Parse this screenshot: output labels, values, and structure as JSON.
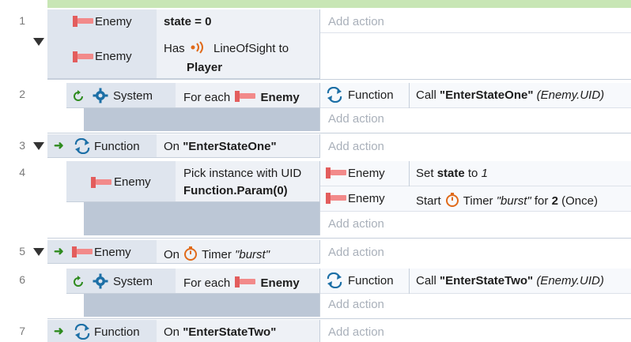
{
  "events": [
    {
      "number": "1",
      "conditions": [
        {
          "object": "Enemy",
          "text": "state = 0"
        },
        {
          "object": "Enemy",
          "has": "Has",
          "behavior": "LineOfSight",
          "to": "to",
          "target": "Player"
        }
      ],
      "actions": [
        "Add action"
      ]
    },
    {
      "number": "2",
      "object": "System",
      "cond_prefix": "For each",
      "cond_object": "Enemy",
      "action_object": "Function",
      "action_call": "Call",
      "action_name": "\"EnterStateOne\"",
      "action_param": "(Enemy.UID)",
      "add_action": "Add action"
    },
    {
      "number": "3",
      "object": "Function",
      "cond_prefix": "On",
      "cond_name": "\"EnterStateOne\"",
      "add_action": "Add action"
    },
    {
      "number": "4",
      "object": "Enemy",
      "cond_line1": "Pick instance with UID",
      "cond_line2": "Function.Param(0)",
      "action1_object": "Enemy",
      "action1_set": "Set",
      "action1_var": "state",
      "action1_to": "to",
      "action1_value": "1",
      "action2_object": "Enemy",
      "action2_start": "Start",
      "action2_timer": "Timer",
      "action2_name": "\"burst\"",
      "action2_for": "for",
      "action2_value": "2",
      "action2_once": "(Once)",
      "add_action": "Add action"
    },
    {
      "number": "5",
      "object": "Enemy",
      "cond_prefix": "On",
      "cond_timer": "Timer",
      "cond_name": "\"burst\"",
      "add_action": "Add action"
    },
    {
      "number": "6",
      "object": "System",
      "cond_prefix": "For each",
      "cond_object": "Enemy",
      "action_object": "Function",
      "action_call": "Call",
      "action_name": "\"EnterStateTwo\"",
      "action_param": "(Enemy.UID)",
      "add_action": "Add action"
    },
    {
      "number": "7",
      "object": "Function",
      "cond_prefix": "On",
      "cond_name": "\"EnterStateTwo\"",
      "add_action": "Add action"
    }
  ],
  "colors": {
    "object_bg": "#dfe5ee",
    "condition_bg": "#eef1f6",
    "gray_fill": "#bcc7d6",
    "green_arrow": "#2e8b1e",
    "timer_orange": "#e06a1a",
    "system_blue": "#1c6fa6",
    "enemy_red": "#e35d5d"
  },
  "icons": [
    "enemy-sprite-icon",
    "gear-icon",
    "refresh-icon",
    "function-icon",
    "timer-icon",
    "line-of-sight-icon",
    "trigger-arrow-icon",
    "collapse-triangle-icon"
  ]
}
